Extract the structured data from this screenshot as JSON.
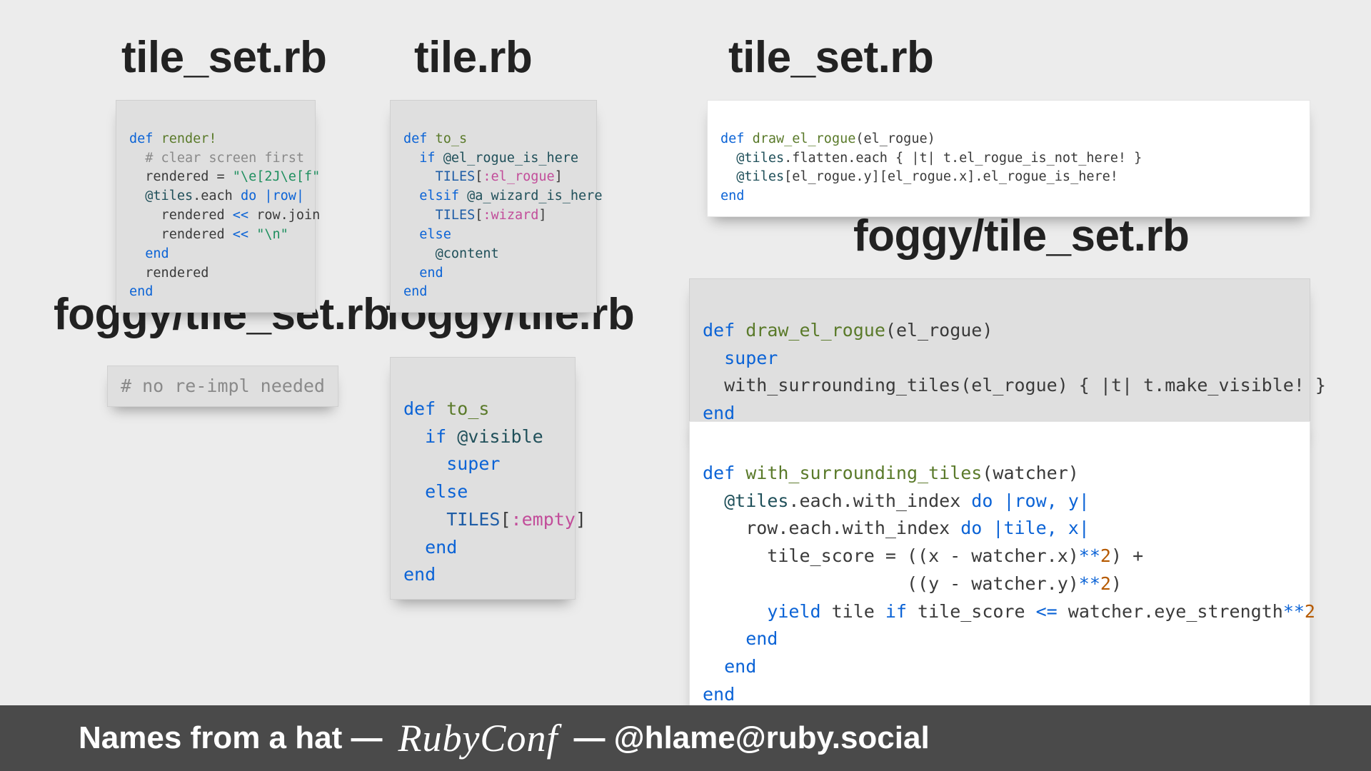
{
  "headings": {
    "col1_top": "tile_set.rb",
    "col2_top": "tile.rb",
    "col1_mid": "foggy/tile_set.rb",
    "col2_mid": "foggy/tile.rb",
    "right_top": "tile_set.rb",
    "right_mid": "foggy/tile_set.rb"
  },
  "code": {
    "render": {
      "l1_kw": "def ",
      "l1_fn": "render!",
      "l2": "  # clear screen first",
      "l3a": "  rendered = ",
      "l3b": "\"\\e[2J\\e[f\"",
      "l4a": "  ",
      "l4b": "@tiles",
      "l4c": ".each ",
      "l4d": "do ",
      "l4e": "|row|",
      "l5a": "    rendered ",
      "l5b": "<<",
      "l5c": " row.join",
      "l6a": "    rendered ",
      "l6b": "<<",
      "l6c": " ",
      "l6d": "\"\\n\"",
      "l7": "  end",
      "l8": "  rendered",
      "l9": "end"
    },
    "tos1": {
      "l1_kw": "def ",
      "l1_fn": "to_s",
      "l2a": "  if ",
      "l2b": "@el_rogue_is_here",
      "l3a": "    ",
      "l3b": "TILES",
      "l3c": "[",
      "l3d": ":el_rogue",
      "l3e": "]",
      "l4a": "  elsif ",
      "l4b": "@a_wizard_is_here",
      "l5a": "    ",
      "l5b": "TILES",
      "l5c": "[",
      "l5d": ":wizard",
      "l5e": "]",
      "l6": "  else",
      "l7a": "    ",
      "l7b": "@content",
      "l8": "  end",
      "l9": "end"
    },
    "noreimpl": "# no re-impl needed",
    "tos2": {
      "l1_kw": "def ",
      "l1_fn": "to_s",
      "l2a": "  if ",
      "l2b": "@visible",
      "l3": "    super",
      "l4": "  else",
      "l5a": "    ",
      "l5b": "TILES",
      "l5c": "[",
      "l5d": ":empty",
      "l5e": "]",
      "l6": "  end",
      "l7": "end"
    },
    "draw1": {
      "l1_kw": "def ",
      "l1_fn": "draw_el_rogue",
      "l1_rest": "(el_rogue)",
      "l2a": "  ",
      "l2b": "@tiles",
      "l2c": ".flatten.each { |t| t.el_rogue_is_not_here! }",
      "l3a": "  ",
      "l3b": "@tiles",
      "l3c": "[el_rogue.y][el_rogue.x].el_rogue_is_here!",
      "l4": "end"
    },
    "draw2": {
      "l1_kw": "def ",
      "l1_fn": "draw_el_rogue",
      "l1_rest": "(el_rogue)",
      "l2": "  super",
      "l3": "  with_surrounding_tiles(el_rogue) { |t| t.make_visible! }",
      "l4": "end"
    },
    "surround": {
      "l1_kw": "def ",
      "l1_fn": "with_surrounding_tiles",
      "l1_rest": "(watcher)",
      "l2a": "  ",
      "l2b": "@tiles",
      "l2c": ".each.with_index ",
      "l2d": "do ",
      "l2e": "|row, y|",
      "l3a": "    row.each.with_index ",
      "l3d": "do ",
      "l3e": "|tile, x|",
      "l4a": "      tile_score = ((x - watcher.x)",
      "l4b": "**",
      "l4c": "2",
      "l4d": ") +",
      "l5a": "                   ((y - watcher.y)",
      "l5b": "**",
      "l5c": "2",
      "l5d": ")",
      "l6a": "      ",
      "l6b": "yield ",
      "l6c": "tile ",
      "l6d": "if ",
      "l6e": "tile_score ",
      "l6f": "<=",
      "l6g": " watcher.eye_strength",
      "l6h": "**",
      "l6i": "2",
      "l7": "    end",
      "l8": "  end",
      "l9": "end"
    }
  },
  "footer": {
    "left": "Names from a hat —",
    "conf": "RubyConf",
    "right": "— @hlame@ruby.social"
  }
}
